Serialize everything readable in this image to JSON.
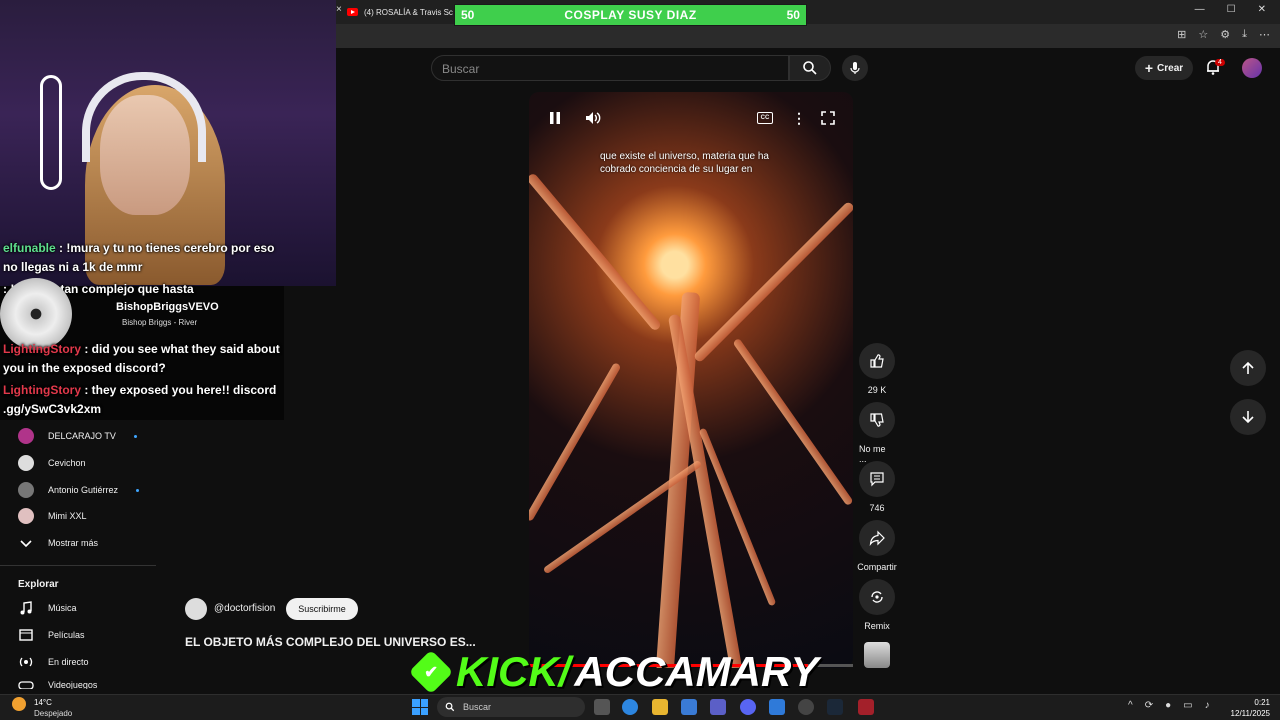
{
  "browser": {
    "tab_title": "(4) ROSALÍA & Travis Sc",
    "close_glyph": "×",
    "window_controls": [
      "—",
      "☐",
      "✕"
    ]
  },
  "banner": {
    "left_value": "50",
    "title": "COSPLAY SUSY DIAZ",
    "right_value": "50",
    "fill_fraction": 1.0
  },
  "youtube": {
    "search_placeholder": "Buscar",
    "create_label": "Crear",
    "notif_count": "4",
    "video": {
      "caption": "que existe el universo, materia que ha cobrado conciencia de su lugar en",
      "cc_label": "CC",
      "progress_fraction": 0.86
    },
    "actions": {
      "like_count": "29 K",
      "dislike_label": "No me ...",
      "comment_count": "746",
      "share_label": "Compartir",
      "remix_label": "Remix"
    },
    "channel": {
      "handle": "@doctorfision",
      "subscribe_label": "Suscribirme",
      "short_title": "EL OBJETO MÁS COMPLEJO DEL UNIVERSO ES..."
    },
    "sidebar": {
      "subscriptions": [
        {
          "name": "DELCARAJO TV",
          "live": true,
          "color": "#b0348a"
        },
        {
          "name": "Cevichon",
          "live": false,
          "color": "#dddddd"
        },
        {
          "name": "Antonio Gutiérrez",
          "live": true,
          "color": "#777777"
        },
        {
          "name": "Mimi XXL",
          "live": false,
          "color": "#e0c0c0"
        }
      ],
      "show_more": "Mostrar más",
      "explore_heading": "Explorar",
      "explore_items": [
        {
          "name": "Música"
        },
        {
          "name": "Películas"
        },
        {
          "name": "En directo"
        },
        {
          "name": "Videojuegos"
        }
      ]
    }
  },
  "stream_overlay": {
    "chat": [
      {
        "user": "elfunable",
        "message": " : !mura y tu no tienes cerebro por eso no llegas ni a 1k de mmr",
        "user_color": "green"
      },
      {
        "user": "",
        "message": " : !mura estan complejo que hasta",
        "user_color": "green"
      },
      {
        "user": "LightingStory",
        "message": " : did you see what they said about you in the exposed discord?",
        "user_color": "red"
      },
      {
        "user": "LightingStory",
        "message": " : they exposed you here!! discord .gg/ySwC3vk2xm",
        "user_color": "red"
      }
    ],
    "music": {
      "artist": "BishopBriggsVEVO",
      "song": "Bishop Briggs - River"
    },
    "kick_word": "KICK/",
    "kick_user": "ACCAMARY",
    "kick_check": "✔"
  },
  "taskbar": {
    "weather_temp": "14°C",
    "weather_desc": "Despejado",
    "search_label": "Buscar",
    "time": "0:21",
    "date": "12/11/2025"
  }
}
